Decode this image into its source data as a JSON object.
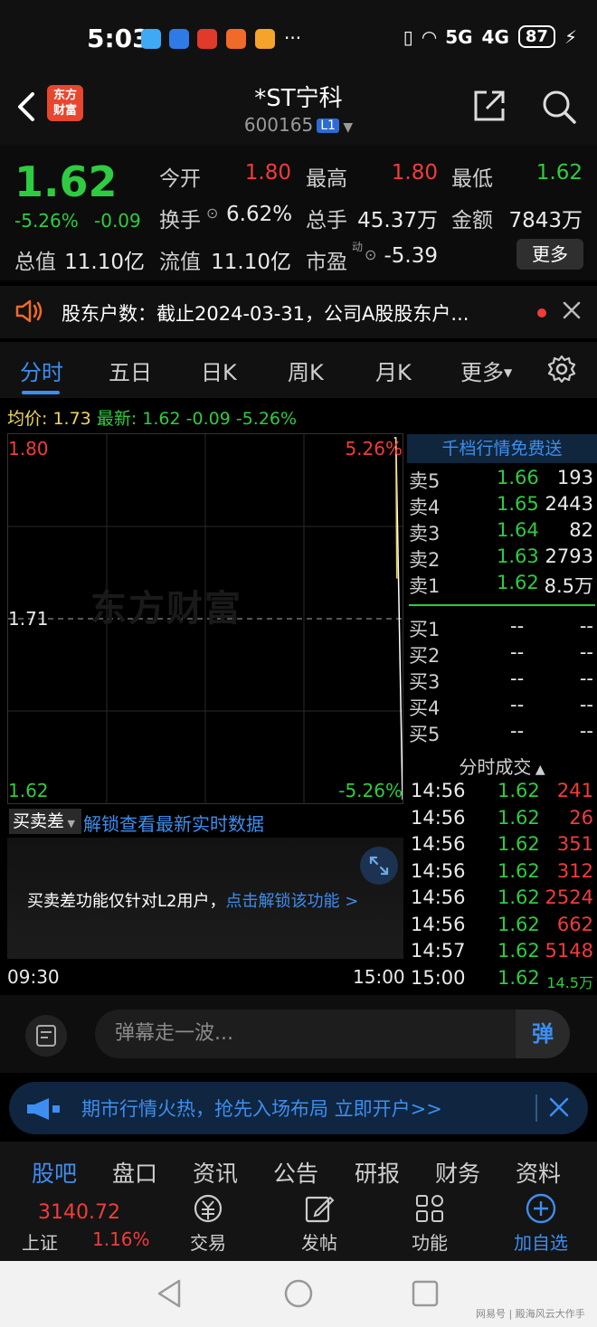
{
  "status_bar": {
    "time": "5:03",
    "battery": "87",
    "net1": "5G",
    "net2": "4G",
    "dots": "···"
  },
  "header": {
    "logo_line1": "东方",
    "logo_line2": "财富",
    "stock_name": "*ST宁科",
    "stock_code": "600165",
    "level_badge": "L1"
  },
  "quote": {
    "price": "1.62",
    "change_pct": "-5.26%",
    "change_amt": "-0.09",
    "open_label": "今开",
    "open": "1.80",
    "high_label": "最高",
    "high": "1.80",
    "low_label": "最低",
    "low": "1.62",
    "turnover_label": "换手",
    "turnover": "6.62%",
    "volume_label": "总手",
    "volume": "45.37万",
    "amount_label": "金额",
    "amount": "7843万",
    "mktcap_label": "总值",
    "mktcap": "11.10亿",
    "float_label": "流值",
    "float": "11.10亿",
    "pe_label": "市盈",
    "pe_sup": "动",
    "pe": "-5.39",
    "more_label": "更多"
  },
  "notice": {
    "text": "股东户数：截止2024-03-31，公司A股股东户..."
  },
  "tabs": [
    {
      "label": "分时"
    },
    {
      "label": "五日"
    },
    {
      "label": "日K"
    },
    {
      "label": "周K"
    },
    {
      "label": "月K"
    },
    {
      "label": "更多"
    }
  ],
  "chart_legend": {
    "avg_label": "均价:",
    "avg": "1.73",
    "last_label": "最新:",
    "last": "1.62",
    "chg": "-0.09",
    "pct": "-5.26%"
  },
  "chart": {
    "y_top": "1.80",
    "y_mid": "1.71",
    "y_bottom": "1.62",
    "pct_top": "5.26%",
    "pct_bottom": "-5.26%",
    "watermark": "东方财富",
    "time_start": "09:30",
    "time_end": "15:00"
  },
  "chart_data": {
    "type": "line",
    "ylim": [
      1.62,
      1.8
    ],
    "xlim": [
      "09:30",
      "15:00"
    ],
    "reference": 1.71,
    "series": [
      {
        "x": [
          "14:56",
          "15:00"
        ],
        "values": [
          1.8,
          1.62
        ]
      }
    ]
  },
  "orderbook": {
    "header": "千档行情免费送",
    "asks": [
      {
        "label": "卖5",
        "price": "1.66",
        "vol": "193"
      },
      {
        "label": "卖4",
        "price": "1.65",
        "vol": "2443"
      },
      {
        "label": "卖3",
        "price": "1.64",
        "vol": "82"
      },
      {
        "label": "卖2",
        "price": "1.63",
        "vol": "2793"
      },
      {
        "label": "卖1",
        "price": "1.62",
        "vol": "8.5万"
      }
    ],
    "bids": [
      {
        "label": "买1",
        "price": "--",
        "vol": "--"
      },
      {
        "label": "买2",
        "price": "--",
        "vol": "--"
      },
      {
        "label": "买3",
        "price": "--",
        "vol": "--"
      },
      {
        "label": "买4",
        "price": "--",
        "vol": "--"
      },
      {
        "label": "买5",
        "price": "--",
        "vol": "--"
      }
    ]
  },
  "ticks": {
    "header": "分时成交",
    "rows": [
      {
        "t": "14:56",
        "p": "1.62",
        "v": "241"
      },
      {
        "t": "14:56",
        "p": "1.62",
        "v": "26"
      },
      {
        "t": "14:56",
        "p": "1.62",
        "v": "351"
      },
      {
        "t": "14:56",
        "p": "1.62",
        "v": "312"
      },
      {
        "t": "14:56",
        "p": "1.62",
        "v": "2524"
      },
      {
        "t": "14:56",
        "p": "1.62",
        "v": "662"
      },
      {
        "t": "14:57",
        "p": "1.62",
        "v": "5148"
      },
      {
        "t": "15:00",
        "p": "1.62",
        "v": "14.5万"
      }
    ]
  },
  "spread": {
    "label": "买卖差",
    "link": "解锁查看最新实时数据",
    "msg": "买卖差功能仅针对L2用户，",
    "msg_link": "点击解锁该功能 >"
  },
  "danmu": {
    "placeholder": "弹幕走一波...",
    "button": "弹"
  },
  "ad": {
    "text": "期市行情火热，抢先入场布局 立即开户>>"
  },
  "bottom_tabs": [
    {
      "label": "股吧"
    },
    {
      "label": "盘口"
    },
    {
      "label": "资讯"
    },
    {
      "label": "公告"
    },
    {
      "label": "研报"
    },
    {
      "label": "财务"
    },
    {
      "label": "资料"
    }
  ],
  "toolbar": {
    "index_value": "3140.72",
    "index_name": "上证",
    "index_pct": "1.16%",
    "items": [
      {
        "label": "交易"
      },
      {
        "label": "发帖"
      },
      {
        "label": "功能"
      },
      {
        "label": "加自选"
      }
    ]
  },
  "footer": {
    "watermark": "网易号 | 殿海风云大作手"
  },
  "colors": {
    "up": "#f23b3b",
    "down": "#2ecc40",
    "accent": "#3d8ef0",
    "bg": "#000000"
  }
}
